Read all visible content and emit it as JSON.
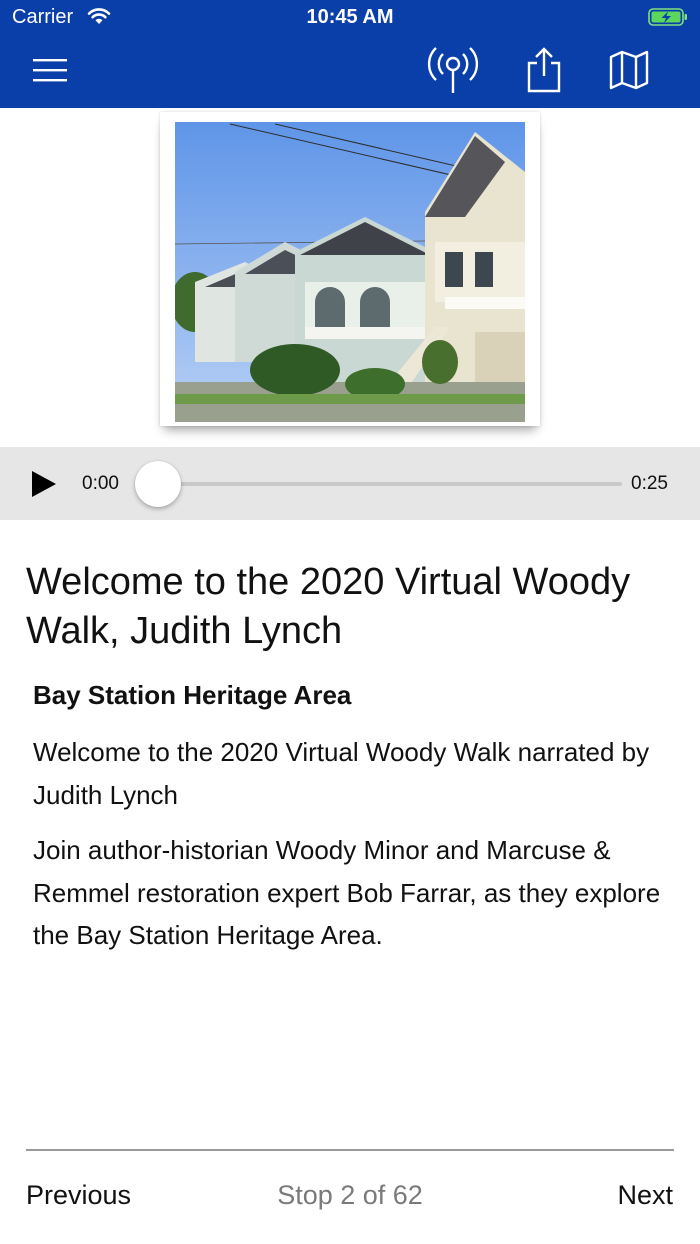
{
  "status_bar": {
    "carrier": "Carrier",
    "time": "10:45 AM"
  },
  "nav": {
    "menu_icon": "hamburger-menu-icon",
    "broadcast_icon": "broadcast-location-icon",
    "share_icon": "share-icon",
    "map_icon": "map-icon",
    "background_color": "#0a3ea8"
  },
  "player": {
    "current_time": "0:00",
    "duration": "0:25",
    "progress": 0
  },
  "content": {
    "title": "Welcome to the 2020 Virtual Woody Walk, Judith Lynch",
    "subtitle": "Bay Station Heritage Area",
    "paragraphs": [
      "Welcome to the 2020 Virtual Woody Walk narrated by Judith Lynch",
      "Join author-historian Woody Minor and Marcuse & Remmel restoration expert Bob Farrar, as they explore the Bay Station Heritage Area."
    ]
  },
  "footer": {
    "previous_label": "Previous",
    "stop_label": "Stop 2 of 62",
    "next_label": "Next"
  }
}
